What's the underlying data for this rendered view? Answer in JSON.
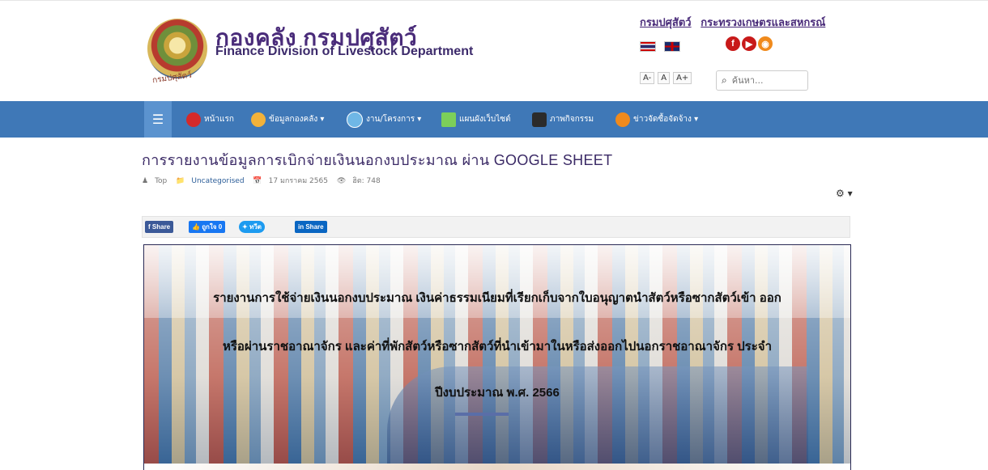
{
  "header": {
    "brand_th": "กองคลัง กรมปศุสัตว์",
    "brand_en": "Finance Division of Livestock Department",
    "seal_text": "กรมปศุสัตว์",
    "gov_links": [
      "กรมปศุสัตว์",
      "กระทรวงเกษตรและสหกรณ์"
    ],
    "font_sizes": [
      "A-",
      "A",
      "A+"
    ],
    "search_placeholder": "ค้นหา..."
  },
  "nav": {
    "items": [
      {
        "label": "หน้าแรก",
        "icon": "home-icon"
      },
      {
        "label": "ข้อมูลกองคลัง ▾",
        "icon": "users-icon"
      },
      {
        "label": "งาน/โครงการ ▾",
        "icon": "project-icon"
      },
      {
        "label": "แผนผังเว็บไซต์",
        "icon": "sitemap-icon"
      },
      {
        "label": "ภาพกิจกรรม",
        "icon": "gallery-icon"
      },
      {
        "label": "ข่าวจัดซื้อจัดจ้าง ▾",
        "icon": "procurement-icon"
      }
    ]
  },
  "article": {
    "title": "การรายงานข้อมูลการเบิกจ่ายเงินนอกงบประมาณ ผ่าน GOOGLE SHEET",
    "author": "Top",
    "category": "Uncategorised",
    "date": "17 มกราคม 2565",
    "hits": "ฮิต: 748"
  },
  "share": {
    "facebook": "Share",
    "like": "ถูกใจ 0",
    "twitter": "ทวีต",
    "linkedin": "Share"
  },
  "banner": {
    "line1": "รายงานการใช้จ่ายเงินนอกงบประมาณ เงินค่าธรรมเนียมที่เรียกเก็บจากใบอนุญาตนำสัตว์หรือซากสัตว์เข้า ออก",
    "line2": "หรือผ่านราชอาณาจักร และค่าที่พักสัตว์หรือซากสัตว์ที่นำเข้ามาในหรือส่งออกไปนอกราชอาณาจักร ประจำ",
    "line3": "ปีงบประมาณ พ.ศ. 2566"
  }
}
